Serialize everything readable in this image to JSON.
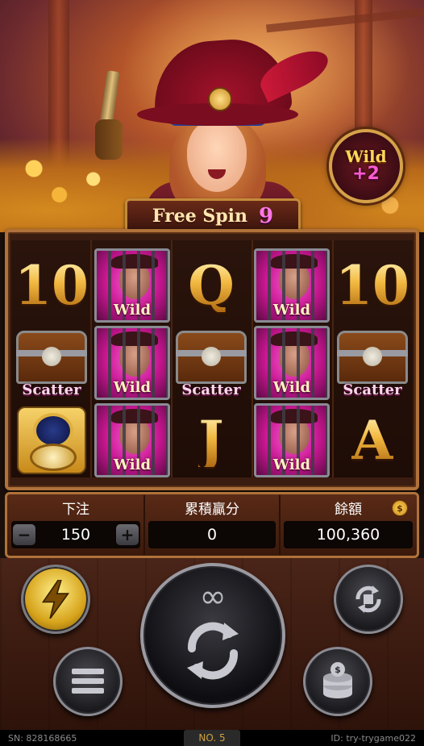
{
  "banner": {
    "free_spin_label": "Free Spin",
    "free_spin_count": "9",
    "wild_bonus_word": "Wild",
    "wild_bonus_amount": "+2"
  },
  "reels": {
    "grid": [
      [
        {
          "type": "letter",
          "text": "10"
        },
        {
          "type": "chest",
          "text": "Scatter"
        },
        {
          "type": "compass",
          "text": ""
        }
      ],
      [
        {
          "type": "wild",
          "text": "Wild"
        },
        {
          "type": "wild",
          "text": "Wild"
        },
        {
          "type": "wild",
          "text": "Wild"
        }
      ],
      [
        {
          "type": "letter",
          "text": "Q"
        },
        {
          "type": "chest",
          "text": "Scatter"
        },
        {
          "type": "letter",
          "text": "J"
        }
      ],
      [
        {
          "type": "wild",
          "text": "Wild"
        },
        {
          "type": "wild",
          "text": "Wild"
        },
        {
          "type": "wild",
          "text": "Wild"
        }
      ],
      [
        {
          "type": "letter",
          "text": "10"
        },
        {
          "type": "chest",
          "text": "Scatter"
        },
        {
          "type": "letter",
          "text": "A"
        }
      ]
    ]
  },
  "info": {
    "bet_label": "下注",
    "bet_value": "150",
    "winnings_label": "累積贏分",
    "winnings_value": "0",
    "balance_label": "餘額",
    "balance_value": "100,360",
    "balance_icon": "dollar-coin-icon"
  },
  "controls": {
    "spin_icon": "refresh-arrows-icon",
    "infinity_symbol": "∞",
    "turbo_icon": "lightning-icon",
    "autoplay_icon": "autoplay-stop-icon",
    "menu_icon": "hamburger-menu-icon",
    "bet_icon": "coin-stack-icon"
  },
  "footer": {
    "sn": "SN: 828168665",
    "no": "NO. 5",
    "id": "ID: try-trygame022"
  },
  "colors": {
    "gold": "#f0b84a",
    "wild_pink": "#ff5cd6",
    "free_spin_count": "#ff77e6",
    "frame": "#b0723a"
  }
}
